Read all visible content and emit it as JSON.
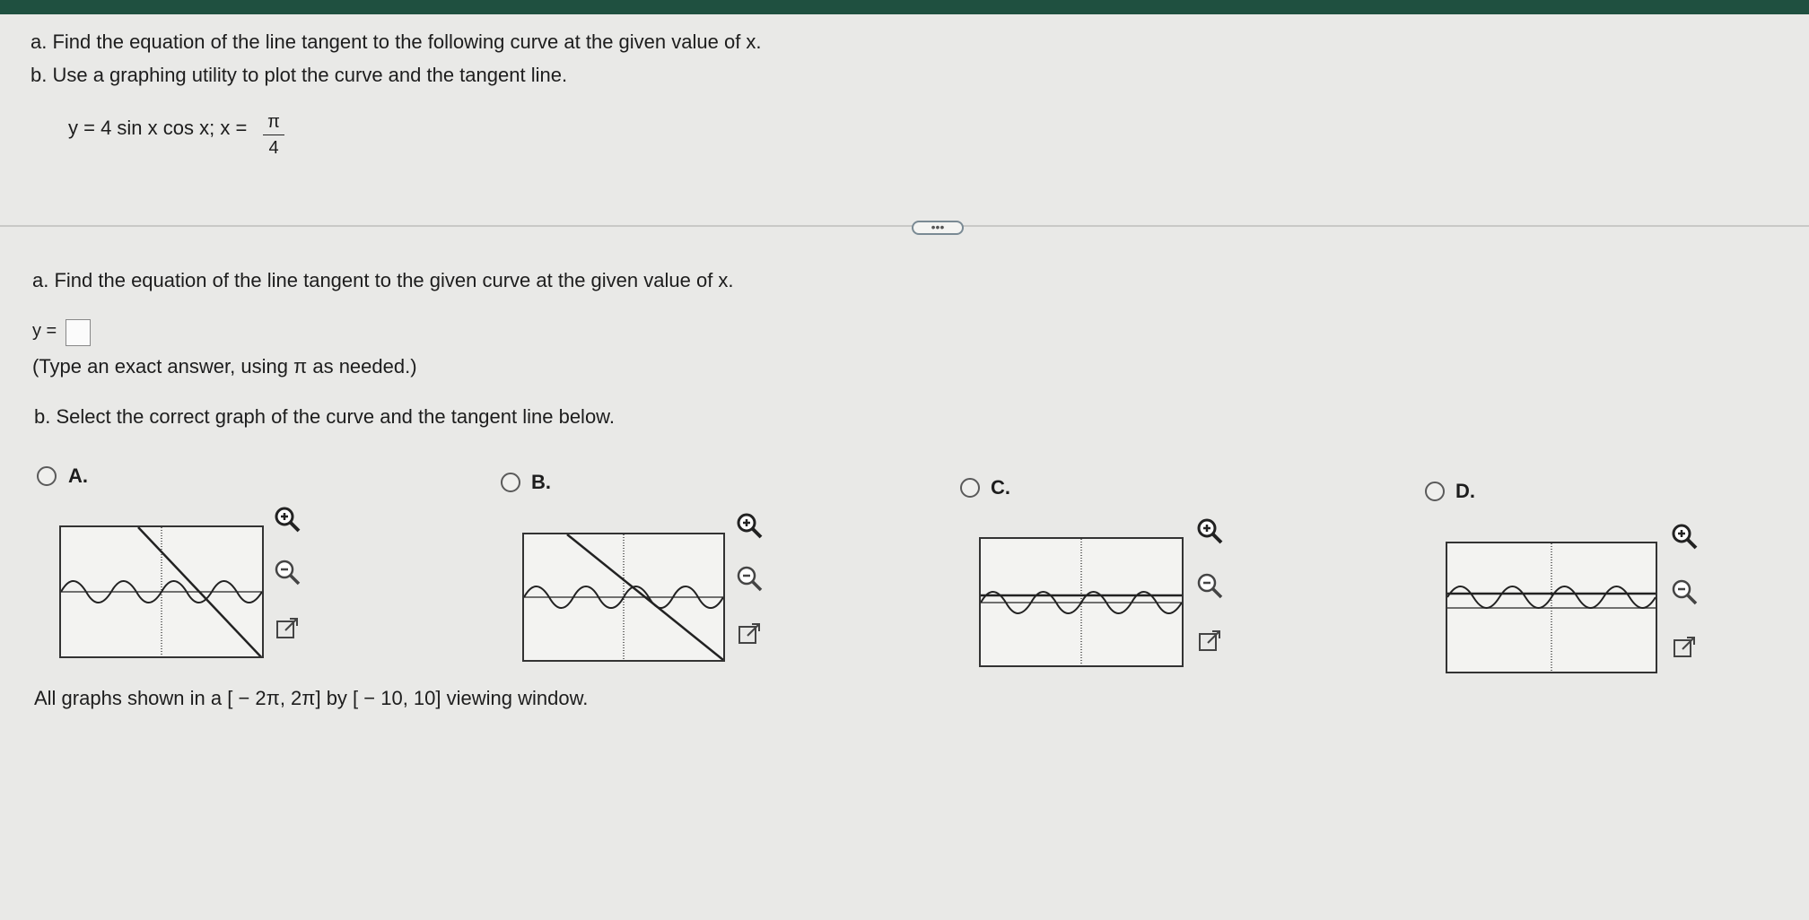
{
  "problem": {
    "line_a": "a. Find the equation of the line tangent to the following curve at the given value of x.",
    "line_b": "b. Use a graphing utility to plot the curve and the tangent line.",
    "equation": "y = 4 sin x cos x; x =",
    "x_numerator": "π",
    "x_denominator": "4"
  },
  "more_button": "•••",
  "part_a": {
    "prompt": "a. Find the equation of the line tangent to the given curve at the given value of x.",
    "y_label": "y =",
    "answer_value": "",
    "hint": "(Type an exact answer, using π as needed.)"
  },
  "part_b": {
    "prompt": "b. Select the correct graph of the curve and the tangent line below.",
    "options": [
      {
        "label": "A.",
        "selected": false,
        "tangent": "steep-down"
      },
      {
        "label": "B.",
        "selected": false,
        "tangent": "moderate-down"
      },
      {
        "label": "C.",
        "selected": false,
        "tangent": "horizontal-mid"
      },
      {
        "label": "D.",
        "selected": false,
        "tangent": "horizontal-high"
      }
    ],
    "tool_icons": [
      "zoom-in-icon",
      "zoom-out-icon",
      "popout-icon"
    ]
  },
  "footer": "All graphs shown in a [ − 2π, 2π] by [ − 10, 10] viewing window."
}
